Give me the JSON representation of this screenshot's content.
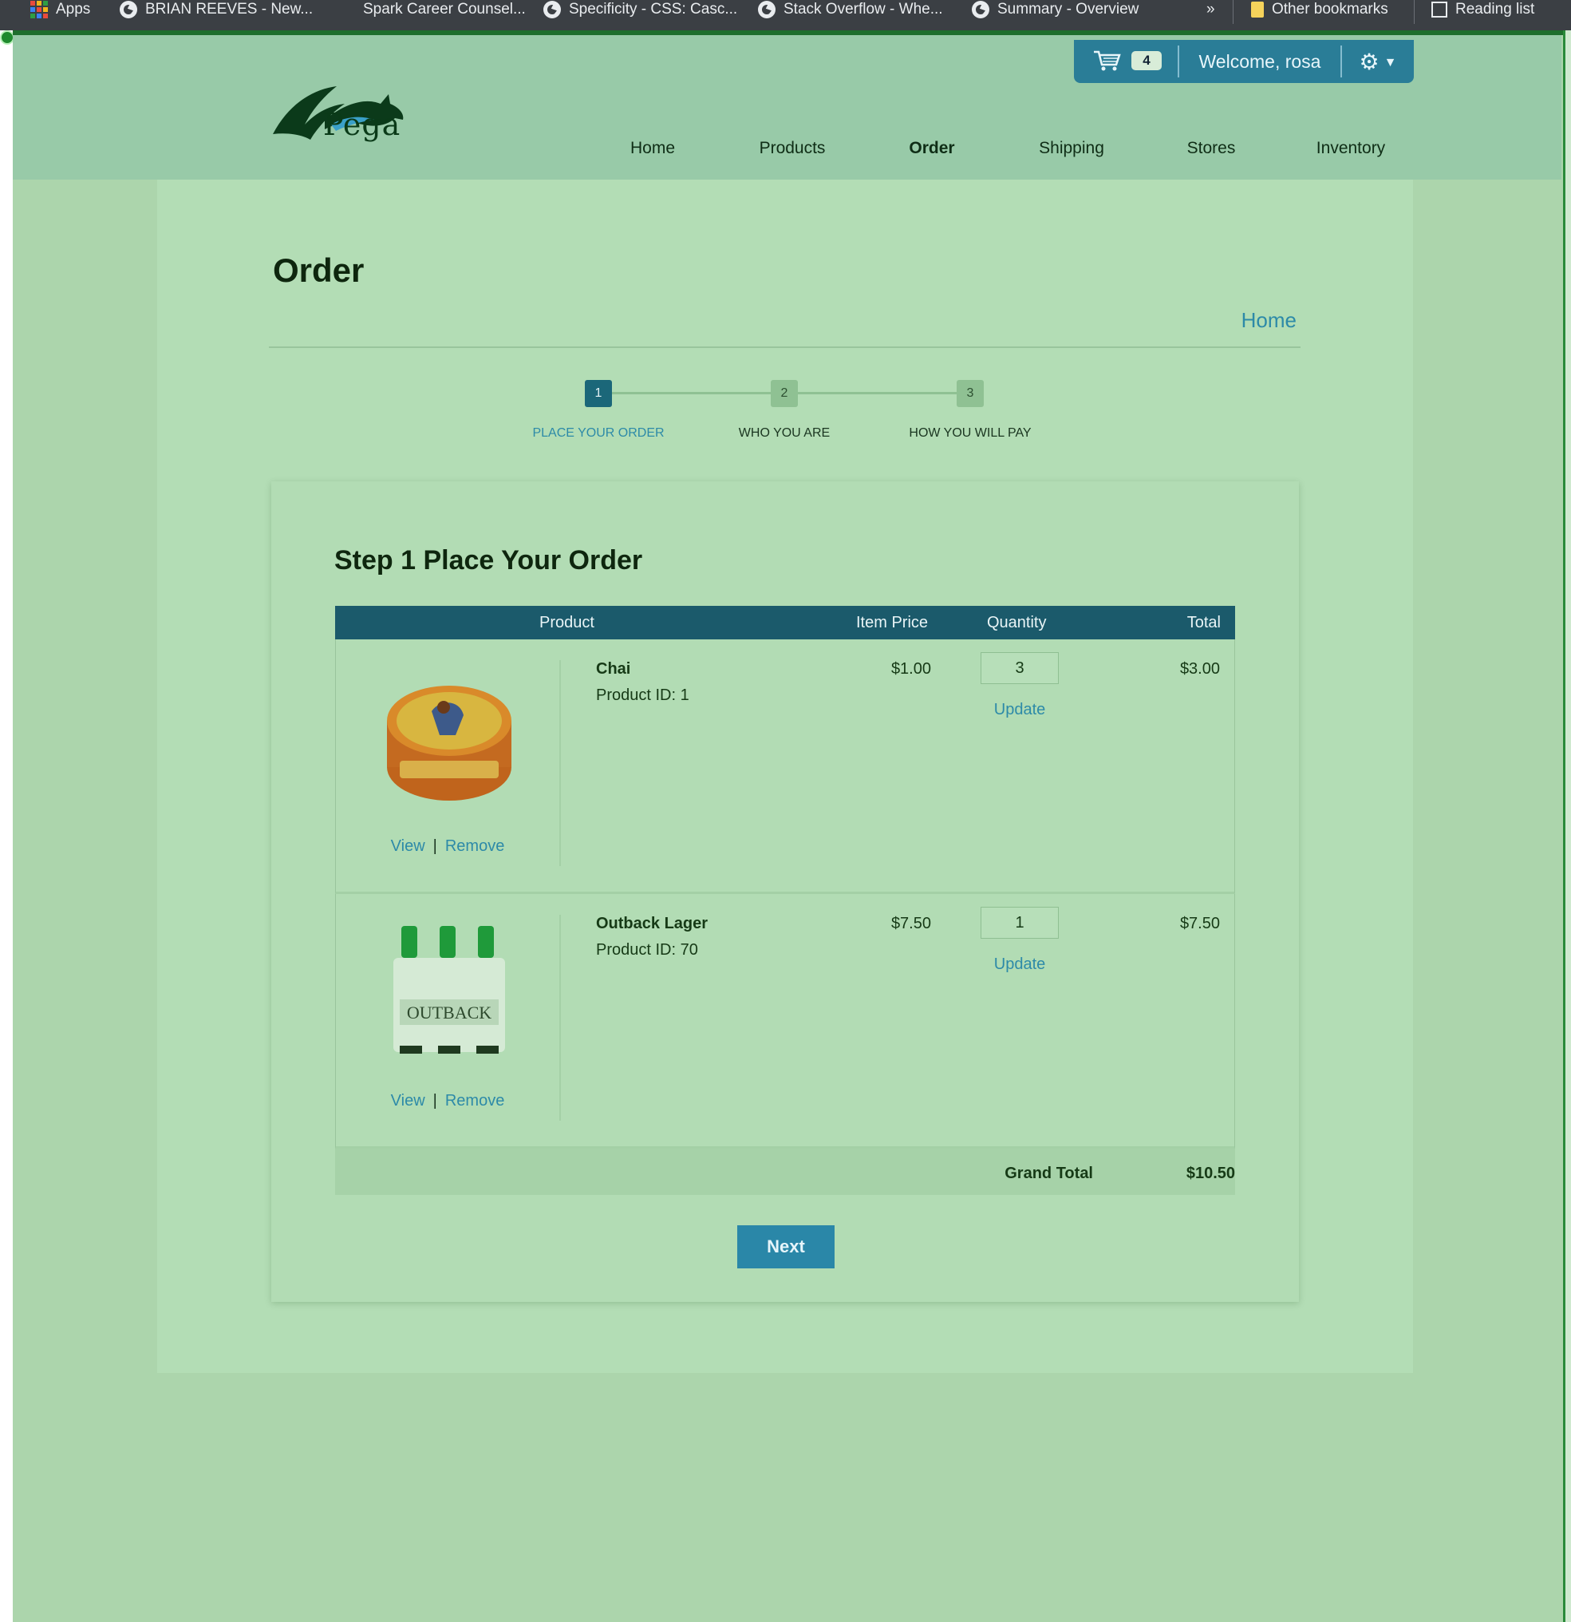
{
  "browser": {
    "bookmarks": [
      {
        "label": "Apps",
        "icon": "apps-grid-icon"
      },
      {
        "label": "BRIAN REEVES - New...",
        "icon": "globe-icon"
      },
      {
        "label": "Spark Career Counsel...",
        "icon": ""
      },
      {
        "label": "Specificity - CSS: Casc...",
        "icon": "globe-icon"
      },
      {
        "label": "Stack Overflow - Whe...",
        "icon": "globe-icon"
      },
      {
        "label": "Summary - Overview",
        "icon": "globe-icon"
      }
    ],
    "overflow": "»",
    "other_bookmarks": "Other bookmarks",
    "reading_list": "Reading list"
  },
  "header": {
    "logo_text": "Pega",
    "cart_count": "4",
    "welcome": "Welcome, rosa",
    "nav": [
      {
        "label": "Home",
        "active": false
      },
      {
        "label": "Products",
        "active": false
      },
      {
        "label": "Order",
        "active": true
      },
      {
        "label": "Shipping",
        "active": false
      },
      {
        "label": "Stores",
        "active": false
      },
      {
        "label": "Inventory",
        "active": false
      }
    ]
  },
  "page": {
    "title": "Order",
    "breadcrumb": "Home"
  },
  "steps": [
    {
      "number": "1",
      "label": "PLACE YOUR ORDER",
      "active": true
    },
    {
      "number": "2",
      "label": "WHO YOU ARE",
      "active": false
    },
    {
      "number": "3",
      "label": "HOW YOU WILL PAY",
      "active": false
    }
  ],
  "order": {
    "heading": "Step 1 Place Your Order",
    "columns": {
      "product": "Product",
      "price": "Item Price",
      "quantity": "Quantity",
      "total": "Total"
    },
    "items": [
      {
        "name": "Chai",
        "product_id": "Product ID: 1",
        "price": "$1.00",
        "quantity": "3",
        "total": "$3.00",
        "view": "View",
        "remove": "Remove",
        "update": "Update",
        "image": "chai-tin"
      },
      {
        "name": "Outback Lager",
        "product_id": "Product ID: 70",
        "price": "$7.50",
        "quantity": "1",
        "total": "$7.50",
        "view": "View",
        "remove": "Remove",
        "update": "Update",
        "image": "beer-sixpack"
      }
    ],
    "grand_total_label": "Grand Total",
    "grand_total": "$10.50",
    "next": "Next"
  },
  "colors": {
    "accent": "#2a87a8",
    "header_bg": "#98caa8",
    "table_header": "#1b5a6b",
    "active_step": "#1b6779"
  }
}
